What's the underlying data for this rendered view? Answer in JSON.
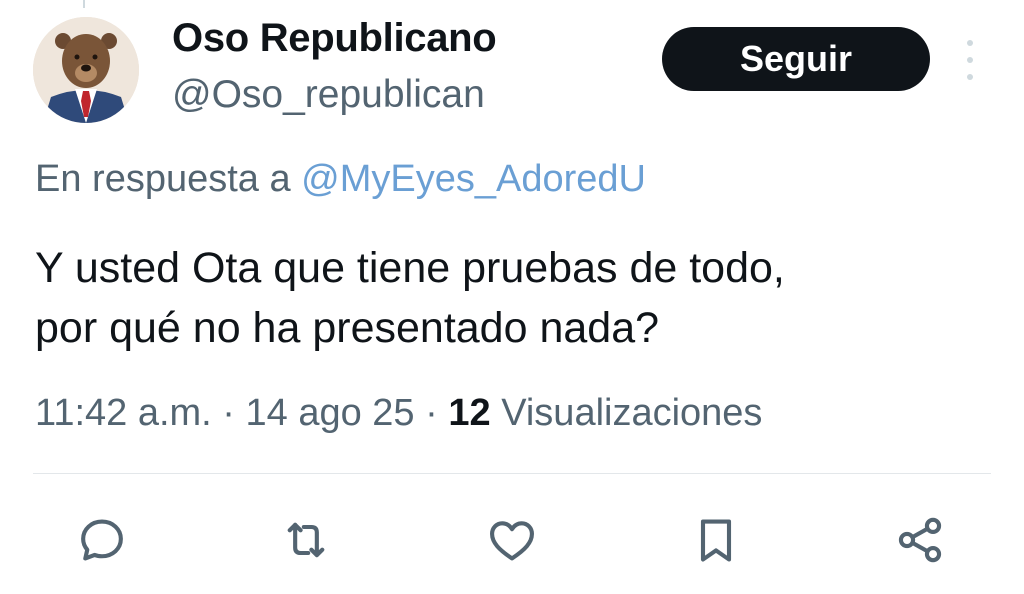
{
  "tweet": {
    "author": {
      "display_name": "Oso Republicano",
      "handle": "@Oso_republican"
    },
    "follow_label": "Seguir",
    "reply_prefix": "En respuesta a",
    "reply_to": "@MyEyes_AdoredU",
    "text_lines": [
      "Y usted Ota que tiene pruebas de todo,",
      "por qué no ha presentado nada?"
    ],
    "time": "11:42 a.m.",
    "separator": "·",
    "date": "14 ago 25",
    "views_count": "12",
    "views_label": "Visualizaciones"
  },
  "actions": [
    {
      "icon": "reply-icon"
    },
    {
      "icon": "retweet-icon"
    },
    {
      "icon": "like-icon"
    },
    {
      "icon": "bookmark-icon"
    },
    {
      "icon": "share-icon"
    }
  ],
  "colors": {
    "text": "#0f1419",
    "secondary": "#536471",
    "link": "#6a9fd4",
    "button": "#0f1419"
  }
}
